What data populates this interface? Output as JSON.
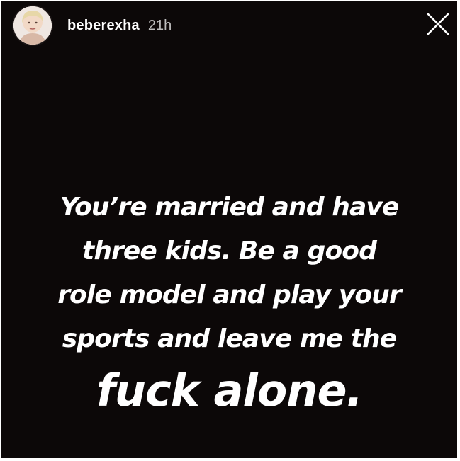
{
  "story": {
    "username": "beberexha",
    "timestamp": "21h",
    "avatar_icon": "profile-photo",
    "close_icon": "close-x-icon"
  },
  "message": {
    "lines": [
      "You’re married and have",
      "three kids. Be a good",
      "role model and play your",
      "sports and leave me the"
    ],
    "final_line": "fuck alone."
  },
  "colors": {
    "background": "#0c0808",
    "text": "#ffffff",
    "timestamp": "#bdbdbd"
  }
}
